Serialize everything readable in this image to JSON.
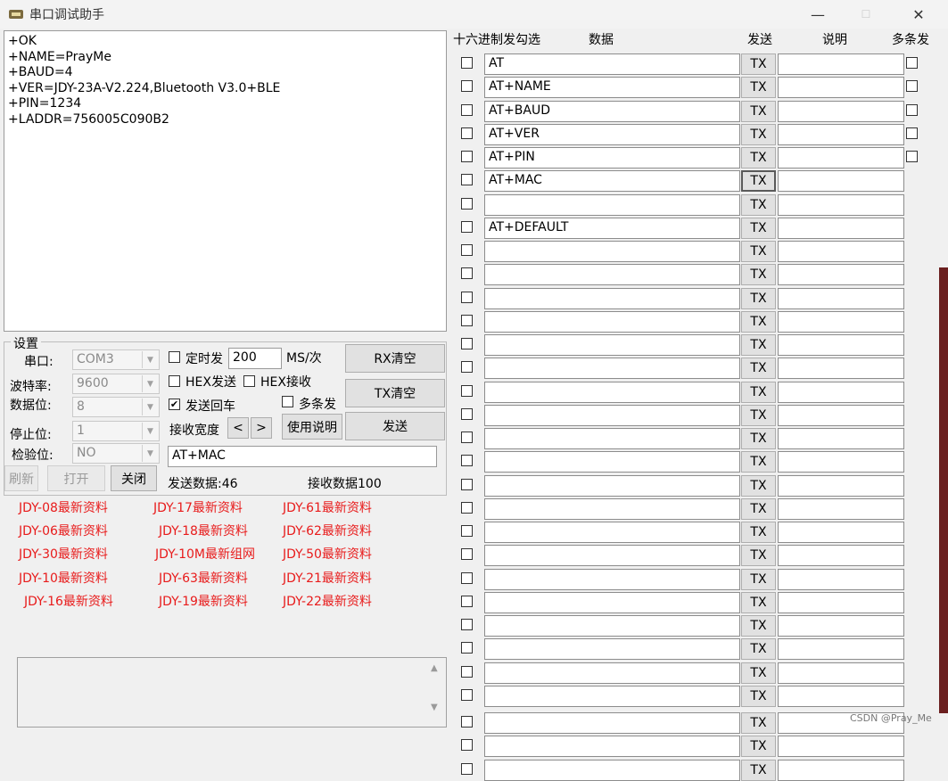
{
  "window": {
    "title": "串口调试助手",
    "minimize": "—",
    "maximize": "☐",
    "close": "✕"
  },
  "receive": {
    "text": "+OK\n+NAME=PrayMe\n+BAUD=4\n+VER=JDY-23A-V2.224,Bluetooth V3.0+BLE\n+PIN=1234\n+LADDR=756005C090B2"
  },
  "settings": {
    "group_title": "设置",
    "port_label": "串口:",
    "port_value": "COM3",
    "baud_label": "波特率:",
    "baud_value": "9600",
    "databits_label": "数据位:",
    "databits_value": "8",
    "stopbits_label": "停止位:",
    "stopbits_value": "1",
    "parity_label": "检验位:",
    "parity_value": "NO",
    "timed_send_label": "定时发",
    "timed_value": "200",
    "timed_unit": "MS/次",
    "hex_send_label": "HEX发送",
    "hex_recv_label": "HEX接收",
    "send_cr_label": "发送回车",
    "send_cr_checked": "✔",
    "multi_send_label": "多条发",
    "recv_width_label": "接收宽度",
    "prev": "<",
    "next": ">",
    "usage_btn": "使用说明",
    "rx_clear": "RX清空",
    "tx_clear": "TX清空",
    "send_btn": "发送",
    "refresh_btn": "刷新",
    "open_btn": "打开",
    "close_btn": "关闭",
    "send_input": "AT+MAC",
    "sent_count": "发送数据:46",
    "recv_count": "接收数据100"
  },
  "links": [
    [
      "JDY-08最新资料",
      "JDY-17最新资料",
      "JDY-61最新资料"
    ],
    [
      "JDY-06最新资料",
      "JDY-18最新资料",
      "JDY-62最新资料"
    ],
    [
      "JDY-30最新资料",
      "JDY-10M最新组网",
      "JDY-50最新资料"
    ],
    [
      "JDY-10最新资料",
      "JDY-63最新资料",
      "JDY-21最新资料"
    ],
    [
      "JDY-16最新资料",
      "JDY-19最新资料",
      "JDY-22最新资料"
    ]
  ],
  "table": {
    "headers": {
      "hex": "十六进制发勾选",
      "data": "数据",
      "send": "发送",
      "desc": "说明",
      "multi": "多条发"
    },
    "tx_label": "TX",
    "rows": [
      "AT",
      "AT+NAME",
      "AT+BAUD",
      "AT+VER",
      "AT+PIN",
      "AT+MAC",
      "",
      "AT+DEFAULT",
      "",
      "",
      "",
      "",
      "",
      "",
      "",
      "",
      "",
      "",
      "",
      "",
      "",
      "",
      "",
      "",
      "",
      "",
      "",
      "",
      "",
      "",
      ""
    ]
  },
  "scroll": {
    "up": "▲",
    "down": "▼"
  },
  "watermark": "CSDN @Pray_Me",
  "colors": {
    "link": "#e81b1b",
    "background": "#f0f0f0"
  }
}
